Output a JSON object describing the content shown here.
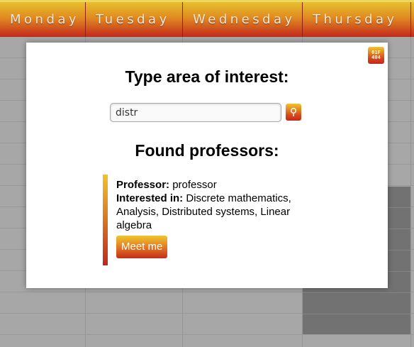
{
  "calendar": {
    "days": [
      "Monday",
      "Tuesday",
      "Wednesday",
      "Thursday"
    ]
  },
  "modal": {
    "title": "Type area of interest:",
    "close_icon": "close-icon",
    "close_glyph": [
      "01F",
      "404"
    ],
    "search": {
      "value": "distr",
      "button_icon": "search-icon"
    },
    "results_title": "Found professors:",
    "results": [
      {
        "professor_label": "Professor:",
        "professor_value": "professor",
        "interest_label": "Interested in:",
        "interest_value": "Discrete mathematics, Analysis, Distributed systems, Linear algebra",
        "meet_label": "Meet me"
      }
    ]
  },
  "colors": {
    "header_top": "#e7c02c",
    "header_bottom": "#c4281c",
    "modal_bg": "#ffffff",
    "accent": "#d6461e"
  }
}
